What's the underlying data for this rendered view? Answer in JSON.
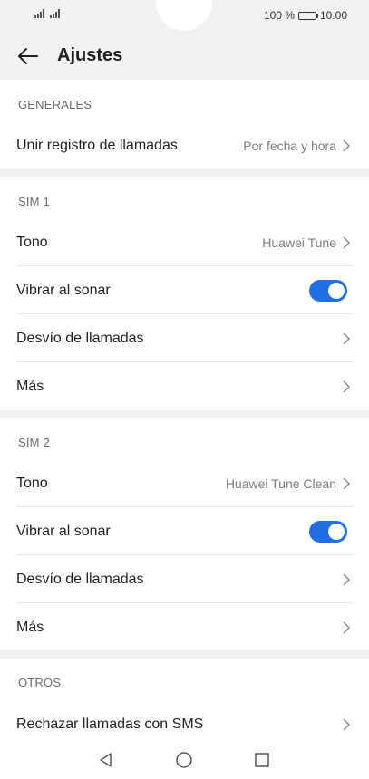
{
  "status_bar": {
    "battery_percent": "100 %",
    "time": "10:00"
  },
  "header": {
    "back_icon": "arrow-left-icon",
    "title": "Ajustes"
  },
  "sections": {
    "generales": {
      "label": "GENERALES",
      "items": [
        {
          "label": "Unir registro de llamadas",
          "value": "Por fecha y hora"
        }
      ]
    },
    "sim1": {
      "label": "SIM 1",
      "items": [
        {
          "label": "Tono",
          "value": "Huawei Tune"
        },
        {
          "label": "Vibrar al sonar",
          "toggle": true
        },
        {
          "label": "Desvío de llamadas"
        },
        {
          "label": "Más"
        }
      ]
    },
    "sim2": {
      "label": "SIM 2",
      "items": [
        {
          "label": "Tono",
          "value": "Huawei Tune Clean"
        },
        {
          "label": "Vibrar al sonar",
          "toggle": true
        },
        {
          "label": "Desvío de llamadas"
        },
        {
          "label": "Más"
        }
      ]
    },
    "otros": {
      "label": "OTROS",
      "items": [
        {
          "label": "Rechazar llamadas con SMS"
        }
      ]
    }
  },
  "navbar": {
    "back_icon": "triangle-back-icon",
    "home_icon": "circle-home-icon",
    "recents_icon": "square-recents-icon"
  },
  "colors": {
    "accent": "#1f6fe5",
    "background": "#f2f2f2",
    "card": "#ffffff",
    "secondary_text": "#7a7a7a"
  }
}
